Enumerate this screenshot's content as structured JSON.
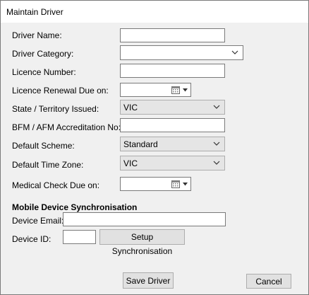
{
  "window": {
    "title": "Maintain Driver"
  },
  "form": {
    "driver_name_label": "Driver Name:",
    "driver_category_label": "Driver Category:",
    "licence_number_label": "Licence Number:",
    "licence_renewal_label": "Licence Renewal Due on:",
    "state_label": "State / Territory Issued:",
    "state_value": "VIC",
    "bfm_label": "BFM / AFM Accreditation No:",
    "scheme_label": "Default Scheme:",
    "scheme_value": "Standard",
    "timezone_label": "Default Time Zone:",
    "timezone_value": "VIC",
    "medical_label": "Medical Check Due on:"
  },
  "sync": {
    "heading": "Mobile Device Synchronisation",
    "email_label": "Device Email:",
    "device_id_label": "Device ID:",
    "setup_button": "Setup Synchronisation"
  },
  "actions": {
    "save": "Save Driver",
    "cancel": "Cancel"
  },
  "icons": {
    "dropdown": "chevron-down-icon",
    "calendar": "calendar-icon"
  }
}
